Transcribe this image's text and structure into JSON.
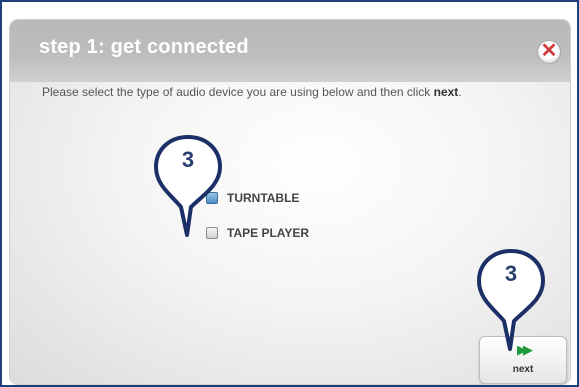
{
  "dialog": {
    "title": "step 1: get connected",
    "close_label": "✕",
    "instruction_prefix": "Please select the type of audio device you are using below and then click ",
    "instruction_bold": "next",
    "instruction_suffix": "."
  },
  "options": [
    {
      "label": "TURNTABLE",
      "checked": true
    },
    {
      "label": "TAPE PLAYER",
      "checked": false
    }
  ],
  "next_button": {
    "arrow_icon": "▶▶",
    "label": "next",
    "accent": "#1f9a3b"
  },
  "callouts": [
    {
      "number": "3"
    },
    {
      "number": "3"
    }
  ],
  "colors": {
    "frame_border": "#1f3f7a",
    "callout_stroke": "#1c2f66",
    "callout_text": "#2a3f6f",
    "close_x": "#d23b3b"
  }
}
